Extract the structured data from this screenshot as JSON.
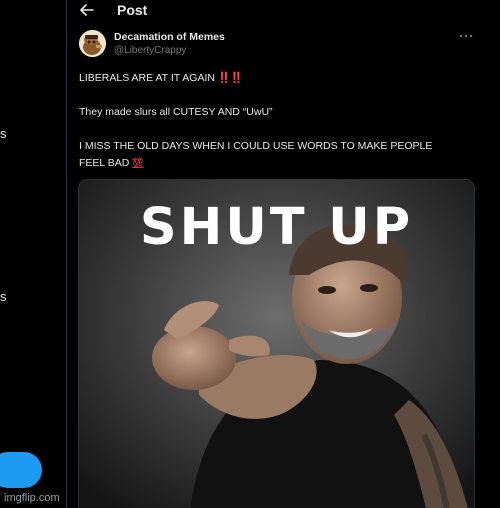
{
  "left_nav": {
    "fragment_1": "s",
    "fragment_2": "s"
  },
  "header": {
    "title": "Post"
  },
  "tweet": {
    "author_name": "Decamation of Memes",
    "author_handle": "@LibertyCrappy",
    "line1": "LIBERALS ARE AT IT AGAIN",
    "line1_emoji": "‼️‼️",
    "line2": "They made slurs all CUTESY AND “UwU”",
    "line3": "I MISS THE OLD DAYS WHEN I COULD USE WORDS TO MAKE PEOPLE",
    "line4": "FEEL BAD",
    "line4_emoji": "💯",
    "media_caption": "SHUT UP"
  },
  "watermark": "imgflip.com",
  "colors": {
    "accent": "#1d9bf0",
    "background": "#000000",
    "text": "#e7e9ea",
    "muted": "#71767b",
    "emoji_red": "#f4212e"
  }
}
